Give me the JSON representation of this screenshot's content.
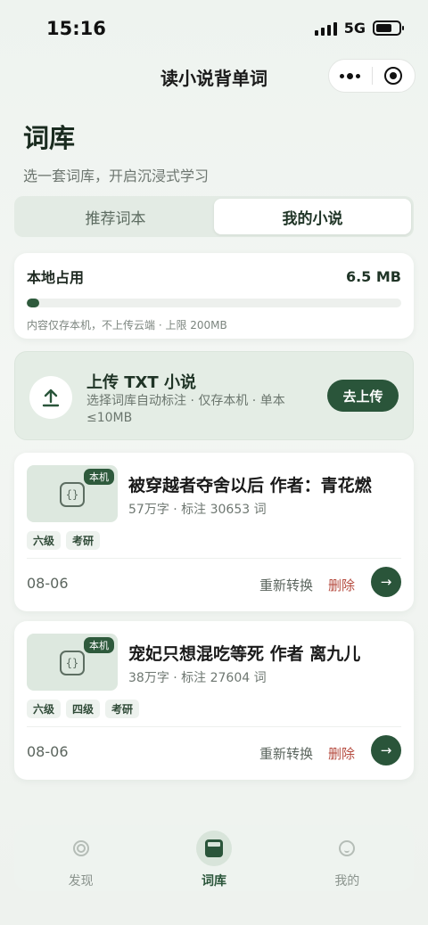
{
  "status_bar": {
    "time": "15:16",
    "network": "5G"
  },
  "nav": {
    "title": "读小说背单词"
  },
  "header": {
    "title": "词库",
    "subtitle": "选一套词库，开启沉浸式学习"
  },
  "tabs": [
    {
      "label": "推荐词本",
      "active": false
    },
    {
      "label": "我的小说",
      "active": true
    }
  ],
  "storage": {
    "label": "本地占用",
    "value": "6.5 MB",
    "progress_fraction": 0.0325,
    "note": "内容仅存本机，不上传云端 · 上限 200MB"
  },
  "upload": {
    "title": "上传 TXT 小说",
    "desc": "选择词库自动标注 · 仅存本机 · 单本≤10MB",
    "button": "去上传"
  },
  "novels": [
    {
      "badge": "本机",
      "cover_glyph": "{}",
      "title": "被穿越者夺舍以后 作者：青花燃",
      "meta": "57万字 · 标注 30653 词",
      "tags": [
        "六级",
        "考研"
      ],
      "date": "08-06",
      "reconvert": "重新转换",
      "delete": "删除",
      "go": "→"
    },
    {
      "badge": "本机",
      "cover_glyph": "{}",
      "title": "宠妃只想混吃等死 作者 离九儿",
      "meta": "38万字 · 标注 27604 词",
      "tags": [
        "六级",
        "四级",
        "考研"
      ],
      "date": "08-06",
      "reconvert": "重新转换",
      "delete": "删除",
      "go": "→"
    }
  ],
  "tabbar": [
    {
      "label": "发现",
      "icon": "discover-icon",
      "active": false
    },
    {
      "label": "词库",
      "icon": "library-icon",
      "active": true
    },
    {
      "label": "我的",
      "icon": "profile-icon",
      "active": false
    }
  ],
  "colors": {
    "accent": "#2a553a",
    "danger": "#b54a3e",
    "background": "#eef3ef"
  }
}
